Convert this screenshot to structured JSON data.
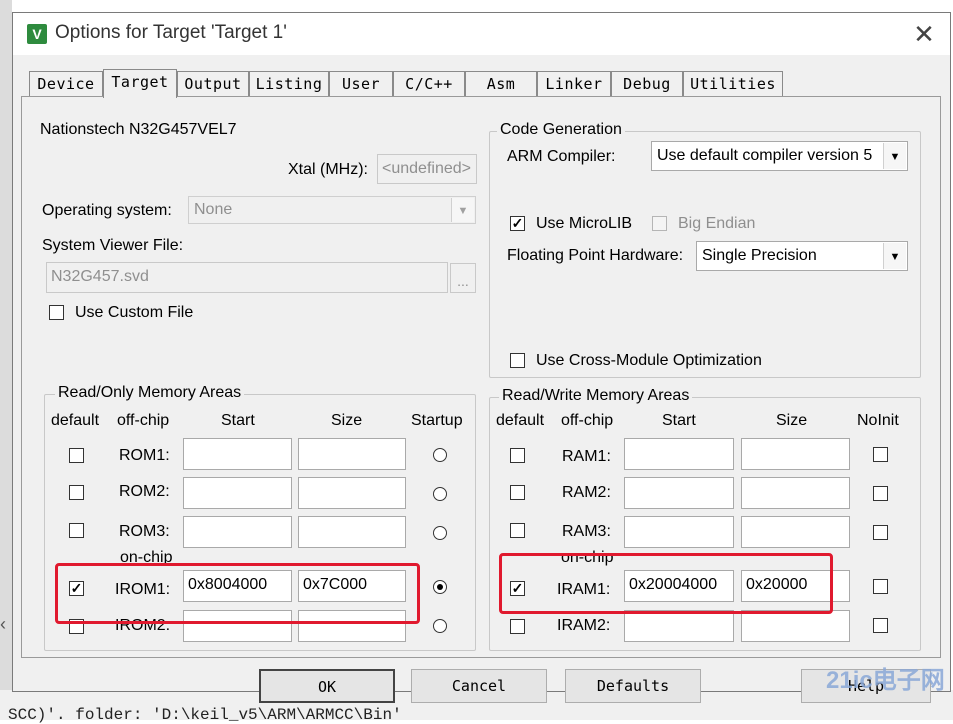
{
  "dialog": {
    "title": "Options for Target 'Target 1'",
    "app_icon_glyph": "V"
  },
  "tabs": [
    {
      "label": "Device"
    },
    {
      "label": "Target",
      "active": true
    },
    {
      "label": "Output"
    },
    {
      "label": "Listing"
    },
    {
      "label": "User"
    },
    {
      "label": "C/C++"
    },
    {
      "label": "Asm"
    },
    {
      "label": "Linker"
    },
    {
      "label": "Debug"
    },
    {
      "label": "Utilities"
    }
  ],
  "target": {
    "device_name": "Nationstech N32G457VEL7",
    "xtal_label": "Xtal (MHz):",
    "xtal_value": "<undefined>",
    "os_label": "Operating system:",
    "os_value": "None",
    "svf_label": "System Viewer File:",
    "svf_value": "N32G457.svd",
    "svf_browse": "...",
    "custom_file_label": "Use Custom File",
    "custom_file_checked": false
  },
  "code_gen": {
    "title": "Code Generation",
    "compiler_label": "ARM Compiler:",
    "compiler_value": "Use default compiler version 5",
    "microlib_label": "Use MicroLIB",
    "microlib_checked": true,
    "bigendian_label": "Big Endian",
    "bigendian_checked": false,
    "fpu_label": "Floating Point Hardware:",
    "fpu_value": "Single Precision",
    "cross_module_label": "Use Cross-Module Optimization",
    "cross_module_checked": false
  },
  "ro_memory": {
    "title": "Read/Only Memory Areas",
    "headers": {
      "default": "default",
      "offchip": "off-chip",
      "start": "Start",
      "size": "Size",
      "startup": "Startup"
    },
    "onchip_label": "on-chip",
    "rows": [
      {
        "name": "ROM1:",
        "default": false,
        "start": "",
        "size": "",
        "startup": false
      },
      {
        "name": "ROM2:",
        "default": false,
        "start": "",
        "size": "",
        "startup": false
      },
      {
        "name": "ROM3:",
        "default": false,
        "start": "",
        "size": "",
        "startup": false
      },
      {
        "name": "IROM1:",
        "default": true,
        "start": "0x8004000",
        "size": "0x7C000",
        "startup": true
      },
      {
        "name": "IROM2:",
        "default": false,
        "start": "",
        "size": "",
        "startup": false
      }
    ]
  },
  "rw_memory": {
    "title": "Read/Write Memory Areas",
    "headers": {
      "default": "default",
      "offchip": "off-chip",
      "start": "Start",
      "size": "Size",
      "noinit": "NoInit"
    },
    "onchip_label": "on-chip",
    "rows": [
      {
        "name": "RAM1:",
        "default": false,
        "start": "",
        "size": "",
        "noinit": false
      },
      {
        "name": "RAM2:",
        "default": false,
        "start": "",
        "size": "",
        "noinit": false
      },
      {
        "name": "RAM3:",
        "default": false,
        "start": "",
        "size": "",
        "noinit": false
      },
      {
        "name": "IRAM1:",
        "default": true,
        "start": "0x20004000",
        "size": "0x20000",
        "noinit": false
      },
      {
        "name": "IRAM2:",
        "default": false,
        "start": "",
        "size": "",
        "noinit": false
      }
    ]
  },
  "buttons": {
    "ok": "OK",
    "cancel": "Cancel",
    "defaults": "Defaults",
    "help": "Help"
  },
  "background": {
    "status_line": "SCC)'. folder: 'D:\\keil_v5\\ARM\\ARMCC\\Bin'"
  },
  "watermark": "21ic电子网",
  "colors": {
    "highlight": "#e0192e",
    "dialog_bg": "#f0f0f0"
  }
}
